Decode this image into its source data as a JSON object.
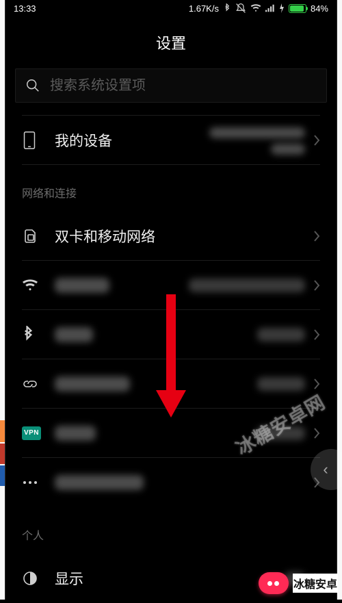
{
  "statusbar": {
    "time": "13:33",
    "netspeed": "1.67K/s",
    "battery_pct": "84%"
  },
  "page": {
    "title": "设置"
  },
  "search": {
    "placeholder": "搜索系统设置项"
  },
  "items": {
    "my_device": {
      "label": "我的设备"
    }
  },
  "sections": {
    "net": {
      "title": "网络和连接"
    },
    "personal": {
      "title": "个人"
    }
  },
  "net_items": {
    "dual_sim": {
      "label": "双卡和移动网络"
    },
    "vpn_badge": "VPN"
  },
  "personal_items": {
    "display": {
      "label": "显示"
    }
  },
  "watermarks": {
    "wm1": "冰糖安卓网",
    "wm2": "冰糖安卓"
  }
}
